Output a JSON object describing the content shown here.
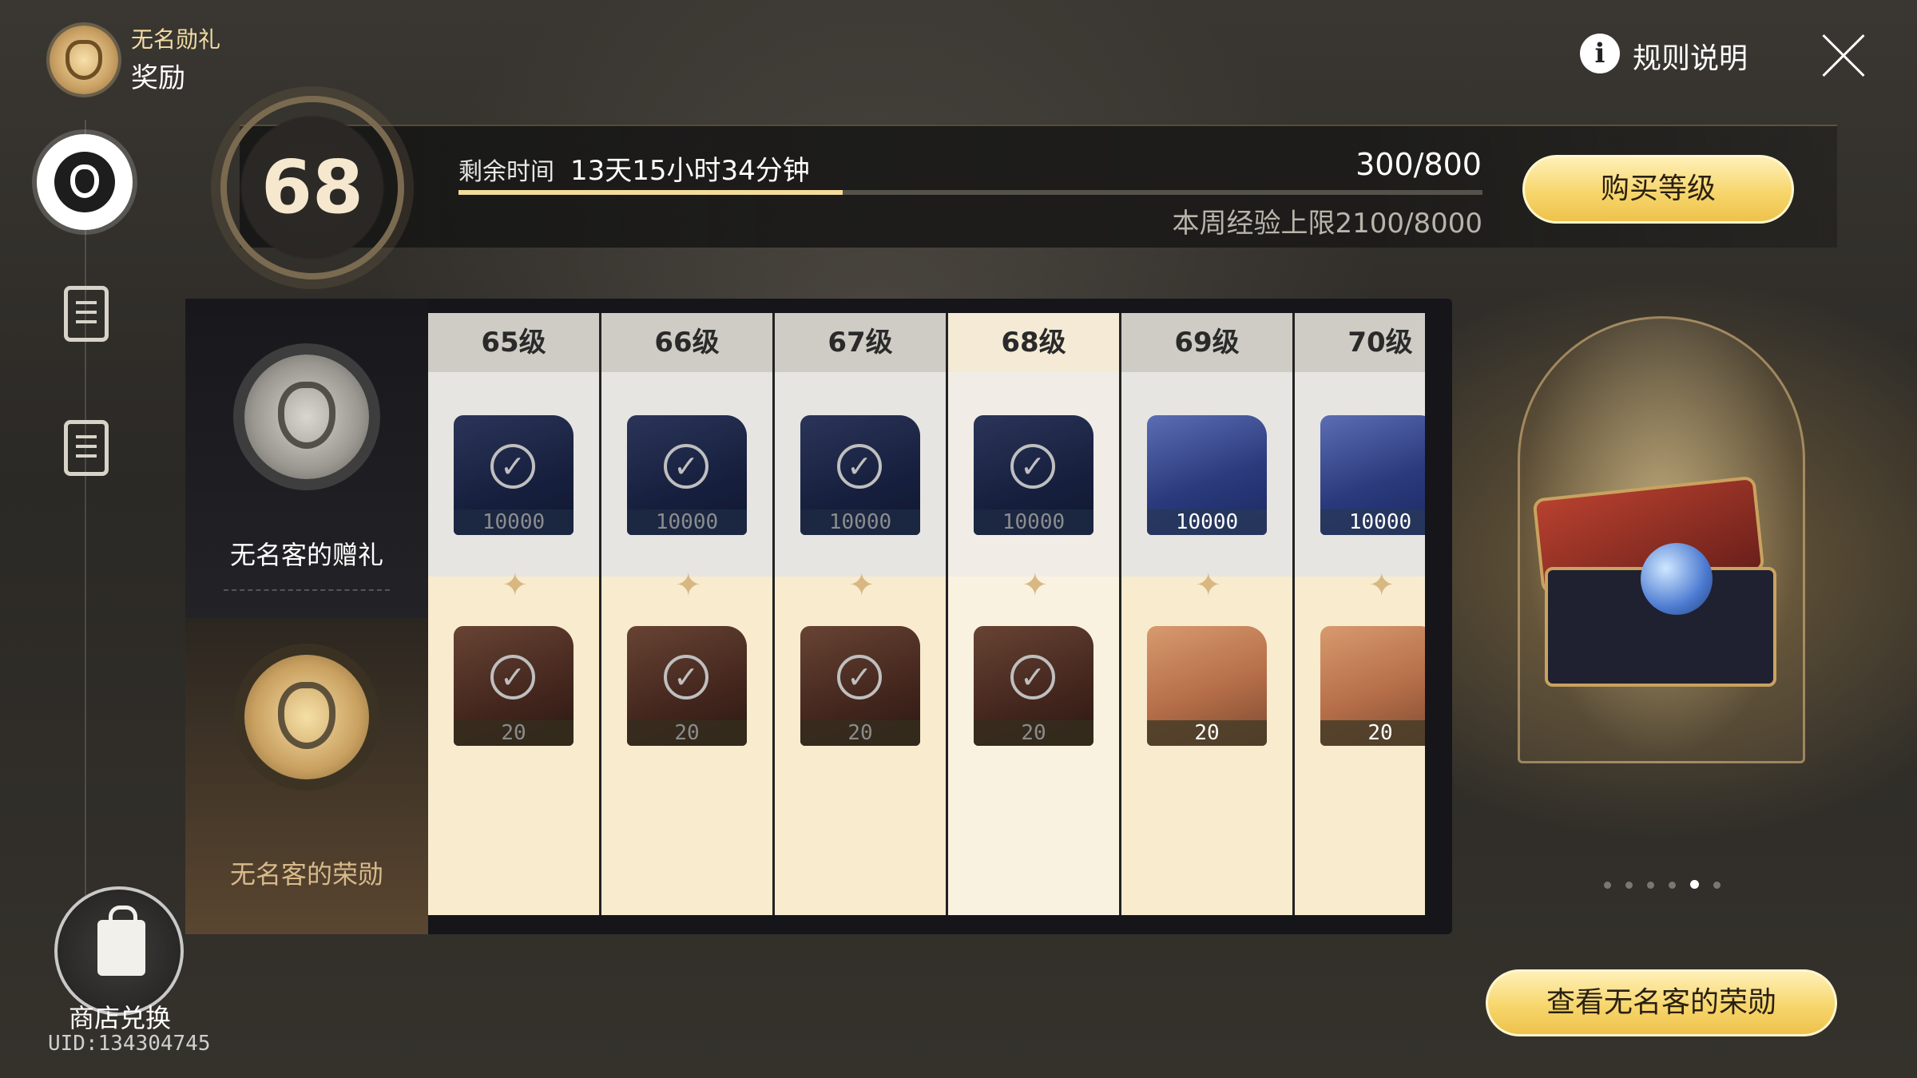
{
  "header": {
    "subtitle": "无名勋礼",
    "title": "奖励"
  },
  "top_right": {
    "rules_label": "规则说明",
    "info_glyph": "i"
  },
  "level": {
    "current": "68",
    "time_label": "剩余时间",
    "time_value": "13天15小时34分钟",
    "exp": "300/800",
    "exp_progress": 0.375,
    "weekly_cap": "本周经验上限2100/8000"
  },
  "buttons": {
    "buy_level": "购买等级",
    "view_honor": "查看无名客的荣勋"
  },
  "tiers": {
    "free": "无名客的赠礼",
    "paid": "无名客的荣勋"
  },
  "columns": [
    {
      "label": "65级",
      "free_qty": "10000",
      "paid_qty": "20",
      "claimed": true,
      "current": false
    },
    {
      "label": "66级",
      "free_qty": "10000",
      "paid_qty": "20",
      "claimed": true,
      "current": false
    },
    {
      "label": "67级",
      "free_qty": "10000",
      "paid_qty": "20",
      "claimed": true,
      "current": false
    },
    {
      "label": "68级",
      "free_qty": "10000",
      "paid_qty": "20",
      "claimed": true,
      "current": true
    },
    {
      "label": "69级",
      "free_qty": "10000",
      "paid_qty": "20",
      "claimed": false,
      "current": false
    },
    {
      "label": "70级",
      "free_qty": "10000",
      "paid_qty": "20",
      "claimed": false,
      "current": false
    }
  ],
  "showcase": {
    "page_count": 6,
    "active_page": 5
  },
  "shop": {
    "label": "商店兑换",
    "uid": "UID:134304745"
  },
  "icons": {
    "logo": "nameless-emblem-icon",
    "close": "close-icon",
    "info": "info-icon",
    "rail": [
      "nameless-badge-icon",
      "clipboard-check-icon",
      "document-search-icon"
    ],
    "shop": "shopping-bag-icon"
  }
}
